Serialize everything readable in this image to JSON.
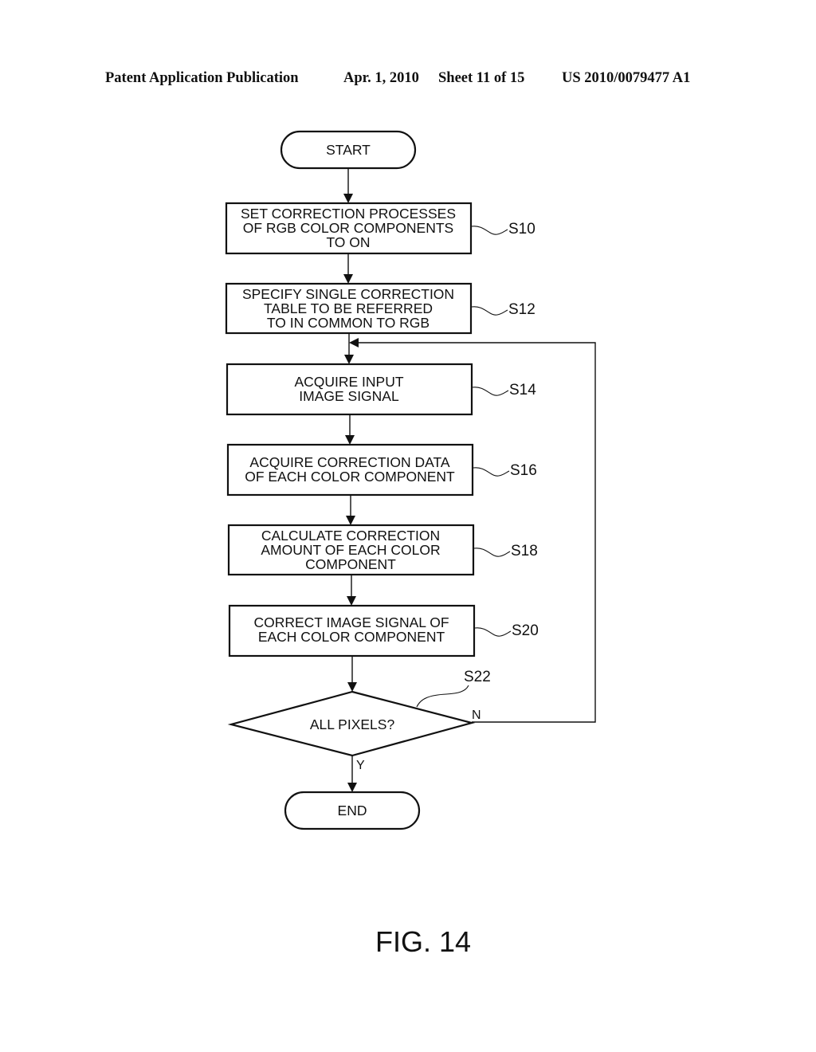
{
  "header": {
    "publication": "Patent Application Publication",
    "date": "Apr. 1, 2010",
    "sheet": "Sheet 11 of 15",
    "number": "US 2010/0079477 A1"
  },
  "flowchart": {
    "start": "START",
    "end": "END",
    "steps": [
      {
        "id": "S10",
        "lines": [
          "SET CORRECTION PROCESSES",
          "OF RGB COLOR COMPONENTS",
          "TO ON"
        ]
      },
      {
        "id": "S12",
        "lines": [
          "SPECIFY SINGLE CORRECTION",
          "TABLE TO BE REFERRED",
          "TO IN COMMON TO RGB"
        ]
      },
      {
        "id": "S14",
        "lines": [
          "ACQUIRE INPUT",
          "IMAGE SIGNAL"
        ]
      },
      {
        "id": "S16",
        "lines": [
          "ACQUIRE CORRECTION DATA",
          "OF EACH COLOR COMPONENT"
        ]
      },
      {
        "id": "S18",
        "lines": [
          "CALCULATE CORRECTION",
          "AMOUNT OF EACH COLOR",
          "COMPONENT"
        ]
      },
      {
        "id": "S20",
        "lines": [
          "CORRECT IMAGE SIGNAL OF",
          "EACH COLOR COMPONENT"
        ]
      }
    ],
    "decision": {
      "id": "S22",
      "text": "ALL PIXELS?",
      "yes_label": "Y",
      "no_label": "N"
    }
  },
  "figure_label": "FIG. 14"
}
